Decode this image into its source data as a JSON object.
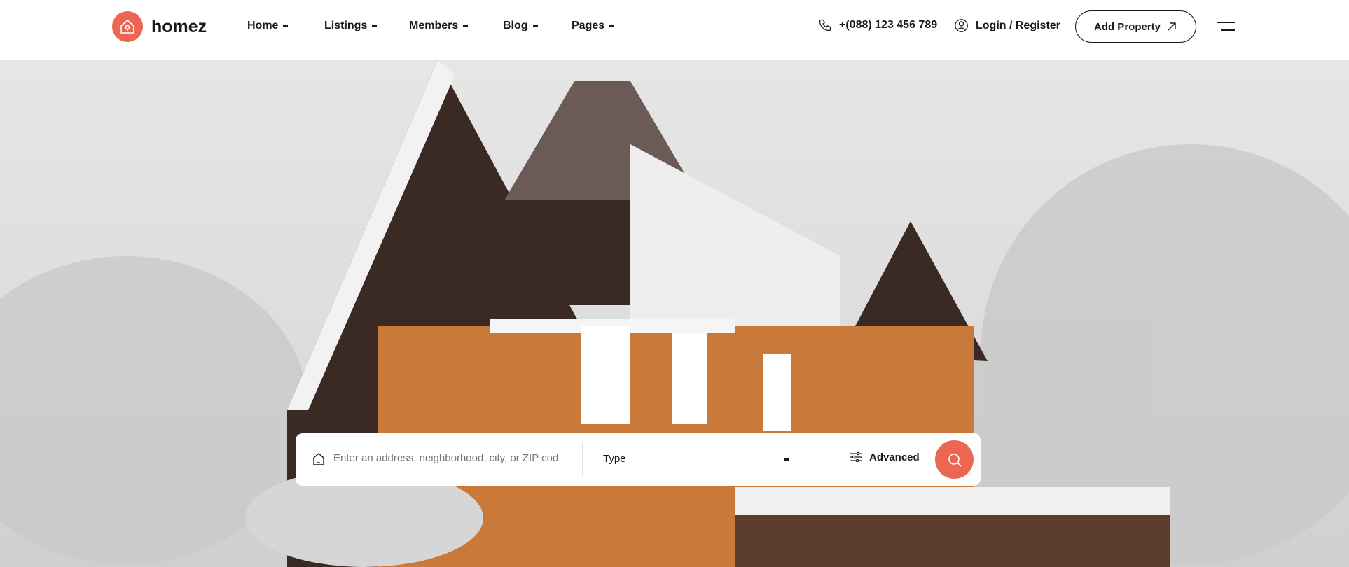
{
  "brand": {
    "name": "homez",
    "color": "#eb6753"
  },
  "nav": [
    {
      "label": "Home"
    },
    {
      "label": "Listings"
    },
    {
      "label": "Members"
    },
    {
      "label": "Blog"
    },
    {
      "label": "Pages"
    }
  ],
  "header": {
    "phone": "+(088) 123 456 789",
    "login": "Login / Register",
    "add_property": "Add Property"
  },
  "search": {
    "placeholder": "Enter an address, neighborhood, city, or ZIP code",
    "type_label": "Type",
    "advanced_label": "Advanced"
  }
}
